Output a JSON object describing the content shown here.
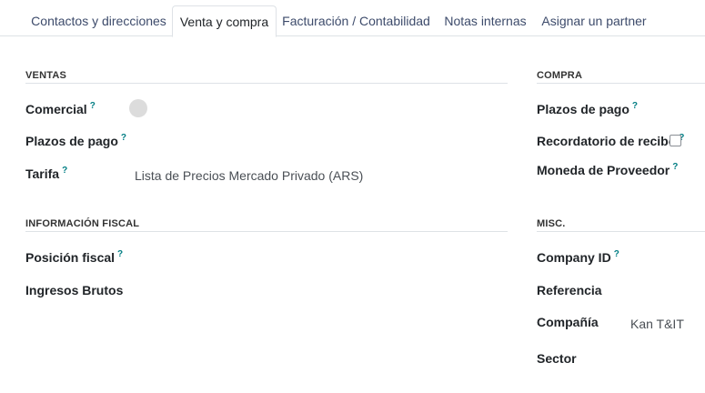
{
  "tabs": [
    {
      "label": "Contactos y direcciones"
    },
    {
      "label": "Venta y compra"
    },
    {
      "label": "Facturación / Contabilidad"
    },
    {
      "label": "Notas internas"
    },
    {
      "label": "Asignar un partner"
    }
  ],
  "help_marker": "?",
  "ventas": {
    "title": "VENTAS",
    "comercial_label": "Comercial",
    "plazos_label": "Plazos de pago",
    "tarifa_label": "Tarifa",
    "tarifa_value": "Lista de Precios Mercado Privado (ARS)"
  },
  "fiscal": {
    "title": "INFORMACIÓN FISCAL",
    "posicion_label": "Posición fiscal",
    "ingresos_label": "Ingresos Brutos"
  },
  "compra": {
    "title": "COMPRA",
    "plazos_label": "Plazos de pago",
    "recordatorio_label": "Recordatorio de recibo",
    "moneda_label": "Moneda de Proveedor"
  },
  "misc": {
    "title": "MISC.",
    "company_id_label": "Company ID",
    "referencia_label": "Referencia",
    "compania_label": "Compañía",
    "compania_value": "Kan T&IT",
    "sector_label": "Sector"
  }
}
